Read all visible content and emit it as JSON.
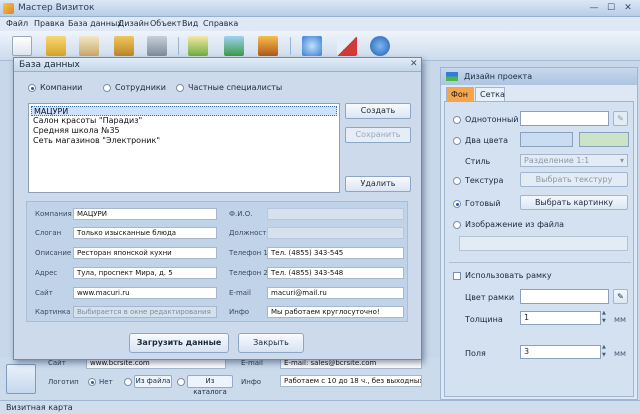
{
  "window": {
    "title": "Мастер Визиток",
    "minimize_glyph": "—",
    "maximize_glyph": "☐",
    "close_glyph": "✕"
  },
  "menu": [
    "Файл",
    "Правка",
    "База данных",
    "Дизайн",
    "Объект",
    "Вид",
    "Справка"
  ],
  "toolbar_icons": [
    "new-document-icon",
    "open-folder-icon",
    "paste-icon",
    "save-icon",
    "print-icon",
    "spellcheck-icon",
    "shapes-icon",
    "image-icon",
    "zoom-icon",
    "flag-icon",
    "help-icon"
  ],
  "dialog": {
    "title": "База данных",
    "close_glyph": "✕",
    "radios": [
      "Компании",
      "Сотрудники",
      "Частные специалисты"
    ],
    "selected_radio": "Компании",
    "list_items": [
      "МАЦУРИ",
      "Салон красоты \"Парадиз\"",
      "Средняя школа №35",
      "Сеть магазинов \"Электроник\""
    ],
    "selected_item": "МАЦУРИ",
    "buttons": {
      "create": "Создать",
      "save": "Сохранить",
      "delete": "Удалить",
      "load": "Загрузить данные",
      "close": "Закрыть"
    },
    "form": {
      "company_label": "Компания",
      "company_value": "МАЦУРИ",
      "fio_label": "Ф.И.О.",
      "fio_value": "",
      "slogan_label": "Слоган",
      "slogan_value": "Только изысканные блюда",
      "position_label": "Должность",
      "position_value": "",
      "description_label": "Описание",
      "description_value": "Ресторан японской кухни",
      "phone1_label": "Телефон 1",
      "phone1_value": "Тел. (4855) 343-545",
      "address_label": "Адрес",
      "address_value": "Тула, проспект Мира, д. 5",
      "phone2_label": "Телефон 2",
      "phone2_value": "Тел. (4855) 343-548",
      "site_label": "Сайт",
      "site_value": "www.macuri.ru",
      "email_label": "E-mail",
      "email_value": "macuri@mail.ru",
      "picture_label": "Картинка",
      "picture_value": "Выбирается в окне редактирования",
      "info_label": "Инфо",
      "info_value": "Мы работаем круглосуточно!"
    }
  },
  "design_panel": {
    "title": "Дизайн проекта",
    "tabs": [
      "Фон",
      "Сетка"
    ],
    "active_tab": "Фон",
    "solid_label": "Однотонный",
    "two_colors_label": "Два цвета",
    "style_label": "Стиль",
    "style_value": "Разделение 1:1",
    "texture_label": "Текстура",
    "texture_button": "Выбрать текстуру",
    "ready_label": "Готовый",
    "ready_button": "Выбрать картинку",
    "image_file_label": "Изображение из файла",
    "use_frame_label": "Использовать рамку",
    "frame_color_label": "Цвет рамки",
    "thickness_label": "Толщина",
    "thickness_value": "1",
    "thickness_unit": "мм",
    "margins_label": "Поля",
    "margins_value": "3",
    "margins_unit": "мм",
    "selected_option": "Готовый",
    "colors": {
      "color1": "#c8dcf2",
      "color2": "#cbe4c6",
      "accent_tab": "#f7a44a"
    }
  },
  "bottom_form": {
    "site_label": "Сайт",
    "site_value": "www.bcrsite.com",
    "email_label": "E-mail",
    "email_value": "E-mail: sales@bcrsite.com",
    "logo_label": "Логотип",
    "logo_none": "Нет",
    "logo_from_file": "Из файла",
    "logo_from_catalog": "Из каталога",
    "info_label": "Инфо",
    "info_value": "Работаем с 10 до 18 ч., без выходных"
  },
  "statusbar": {
    "text": "Визитная карта"
  }
}
